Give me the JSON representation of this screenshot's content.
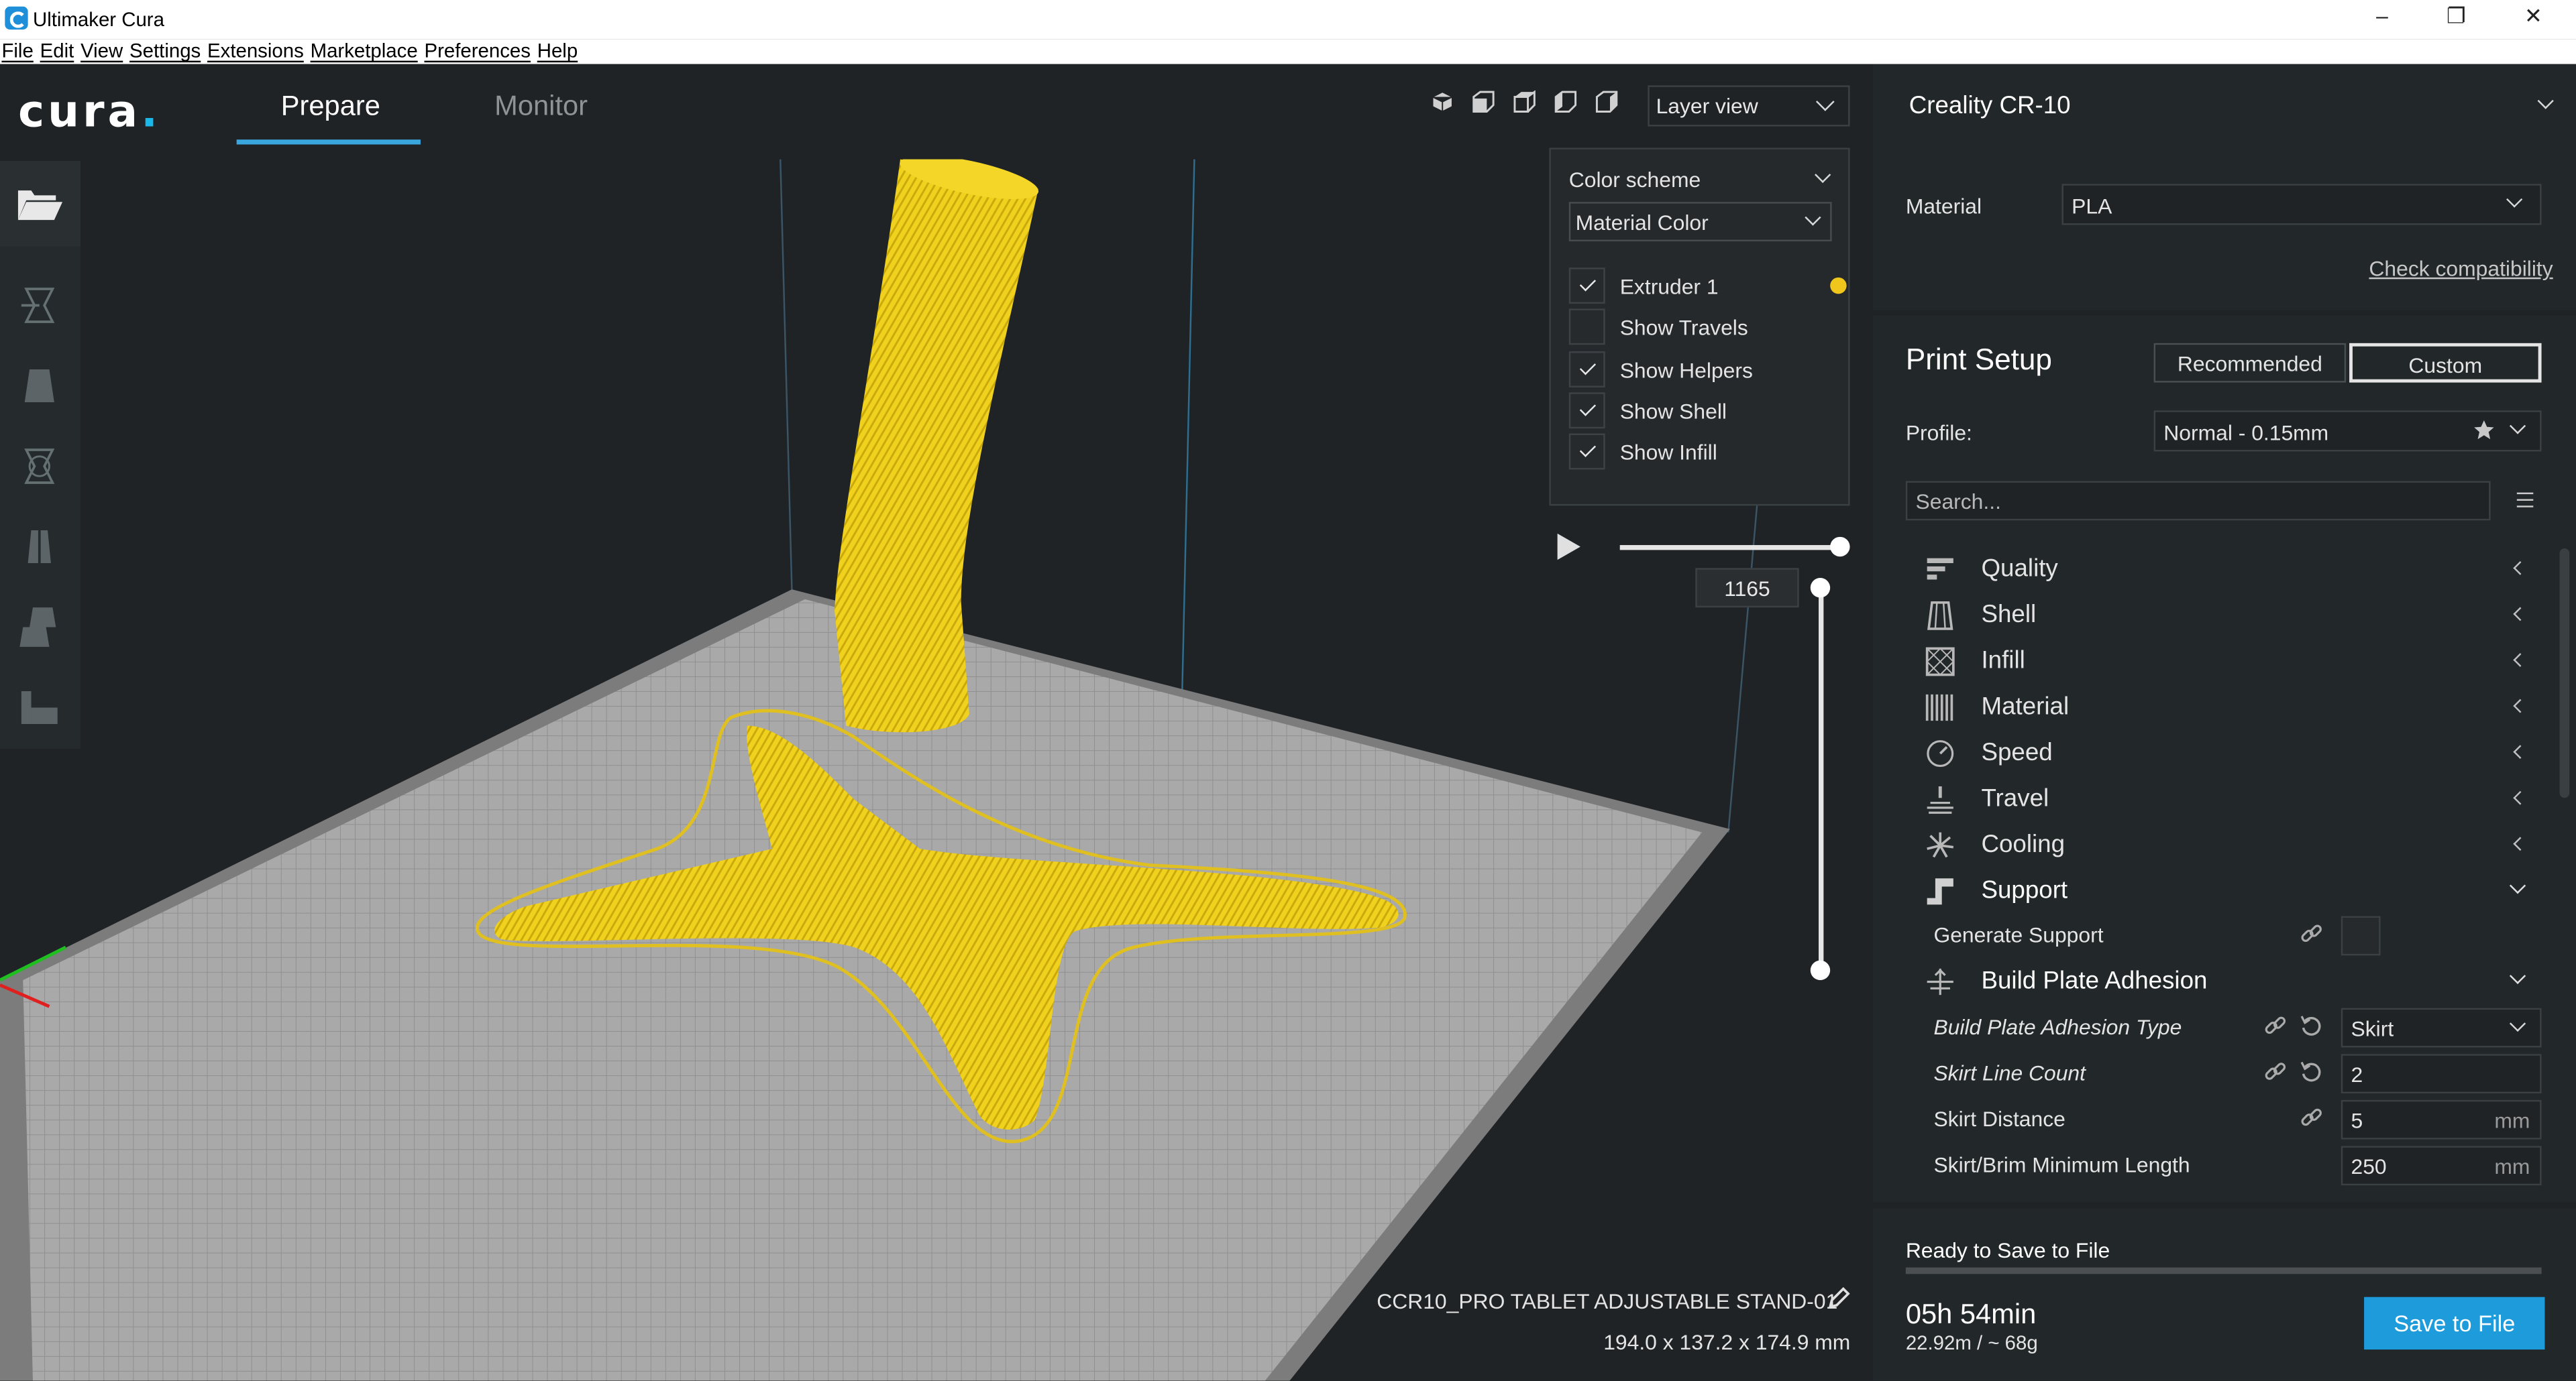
{
  "window": {
    "title": "Ultimaker Cura",
    "controls": [
      "–",
      "❐",
      "✕"
    ]
  },
  "menu": [
    "File",
    "Edit",
    "View",
    "Settings",
    "Extensions",
    "Marketplace",
    "Preferences",
    "Help"
  ],
  "header": {
    "logo": "cura",
    "logo_dot": ".",
    "tabs": {
      "prepare": "Prepare",
      "monitor": "Monitor"
    },
    "active_tab": "Prepare",
    "view_mode": "Layer view"
  },
  "layer_panel": {
    "color_scheme_label": "Color scheme",
    "color_scheme_value": "Material Color",
    "options": [
      {
        "label": "Extruder 1",
        "checked": true
      },
      {
        "label": "Show Travels",
        "checked": false
      },
      {
        "label": "Show Helpers",
        "checked": true
      },
      {
        "label": "Show Shell",
        "checked": true
      },
      {
        "label": "Show Infill",
        "checked": true
      }
    ],
    "extruder_color": "#f0c61c",
    "current_layer": "1165"
  },
  "object": {
    "name": "CCR10_PRO TABLET ADJUSTABLE STAND-01",
    "dimensions": "194.0 x 137.2 x 174.9 mm"
  },
  "printer": {
    "name": "Creality CR-10",
    "material_label": "Material",
    "material_value": "PLA",
    "check_compat": "Check compatibility"
  },
  "print_setup": {
    "title": "Print Setup",
    "modes": {
      "recommended": "Recommended",
      "custom": "Custom"
    },
    "active_mode": "Custom",
    "profile_label": "Profile:",
    "profile_value": "Normal - 0.15mm",
    "search_placeholder": "Search...",
    "categories": {
      "quality": "Quality",
      "shell": "Shell",
      "infill": "Infill",
      "material": "Material",
      "speed": "Speed",
      "travel": "Travel",
      "cooling": "Cooling",
      "support": "Support",
      "adhesion": "Build Plate Adhesion"
    },
    "generate_support": "Generate Support",
    "adhesion_type_label": "Build Plate Adhesion Type",
    "adhesion_type_value": "Skirt",
    "skirt_line_count_label": "Skirt Line Count",
    "skirt_line_count_value": "2",
    "skirt_distance_label": "Skirt Distance",
    "skirt_distance_value": "5",
    "skirt_min_length_label": "Skirt/Brim Minimum Length",
    "skirt_min_length_value": "250",
    "unit_mm": "mm"
  },
  "output": {
    "status": "Ready to Save to File",
    "time": "05h 54min",
    "usage": "22.92m / ~ 68g",
    "save_button": "Save to File"
  },
  "colors": {
    "accent": "#1e9bdb",
    "model": "#f0d11e",
    "background": "#1f2326"
  }
}
